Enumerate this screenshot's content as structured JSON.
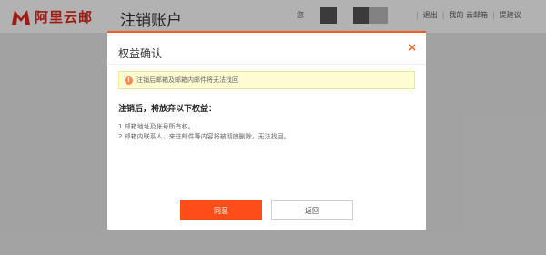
{
  "header": {
    "logo_text": "阿里云邮",
    "title": "注销账户",
    "user_label": "您",
    "nav": [
      "退出",
      "我的 云邮箱",
      "提建议"
    ]
  },
  "modal": {
    "title": "权益确认",
    "close_glyph": "×",
    "warning_icon_glyph": "!",
    "warning_text": "注销后邮箱及邮箱内邮件将无法找回",
    "section_title": "注销后，将放弃以下权益：",
    "items": [
      "1.邮箱地址及帐号所有权。",
      "2.邮箱内联系人、来往邮件等内容将被彻底删除，无法找回。"
    ],
    "buttons": {
      "confirm": "同意",
      "back": "返回"
    }
  },
  "colors": {
    "brand": "#e0291e",
    "accent": "#ff4d1a",
    "warning_bg": "#fffbd3"
  }
}
